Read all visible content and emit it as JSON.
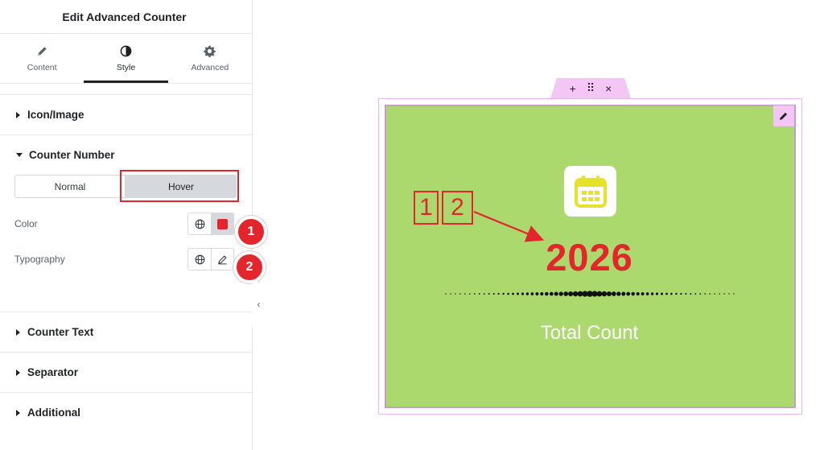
{
  "panel": {
    "title": "Edit Advanced Counter",
    "tabs": [
      {
        "label": "Content",
        "icon": "pencil-icon"
      },
      {
        "label": "Style",
        "icon": "half-circle-icon"
      },
      {
        "label": "Advanced",
        "icon": "gear-icon"
      }
    ],
    "active_tab": "Style",
    "sections": {
      "icon_image": "Icon/Image",
      "counter_number": "Counter Number",
      "counter_text": "Counter Text",
      "separator": "Separator",
      "additional": "Additional"
    },
    "state_switcher": {
      "normal": "Normal",
      "hover": "Hover",
      "active": "Hover"
    },
    "controls": {
      "color_label": "Color",
      "color_value": "#e3262c",
      "typography_label": "Typography"
    },
    "badges": {
      "one": "1",
      "two": "2"
    }
  },
  "canvas": {
    "toolbar": {
      "add": "+",
      "drag": "⠿",
      "close": "×"
    },
    "counter_number": "2026",
    "counter_text": "Total Count",
    "annotation": {
      "box1": "1",
      "box2": "2"
    },
    "colors": {
      "widget_bg": "#acd96d",
      "accent": "#e3262c",
      "icon": "#e6e22a",
      "frame": "#e7b7f0"
    }
  }
}
